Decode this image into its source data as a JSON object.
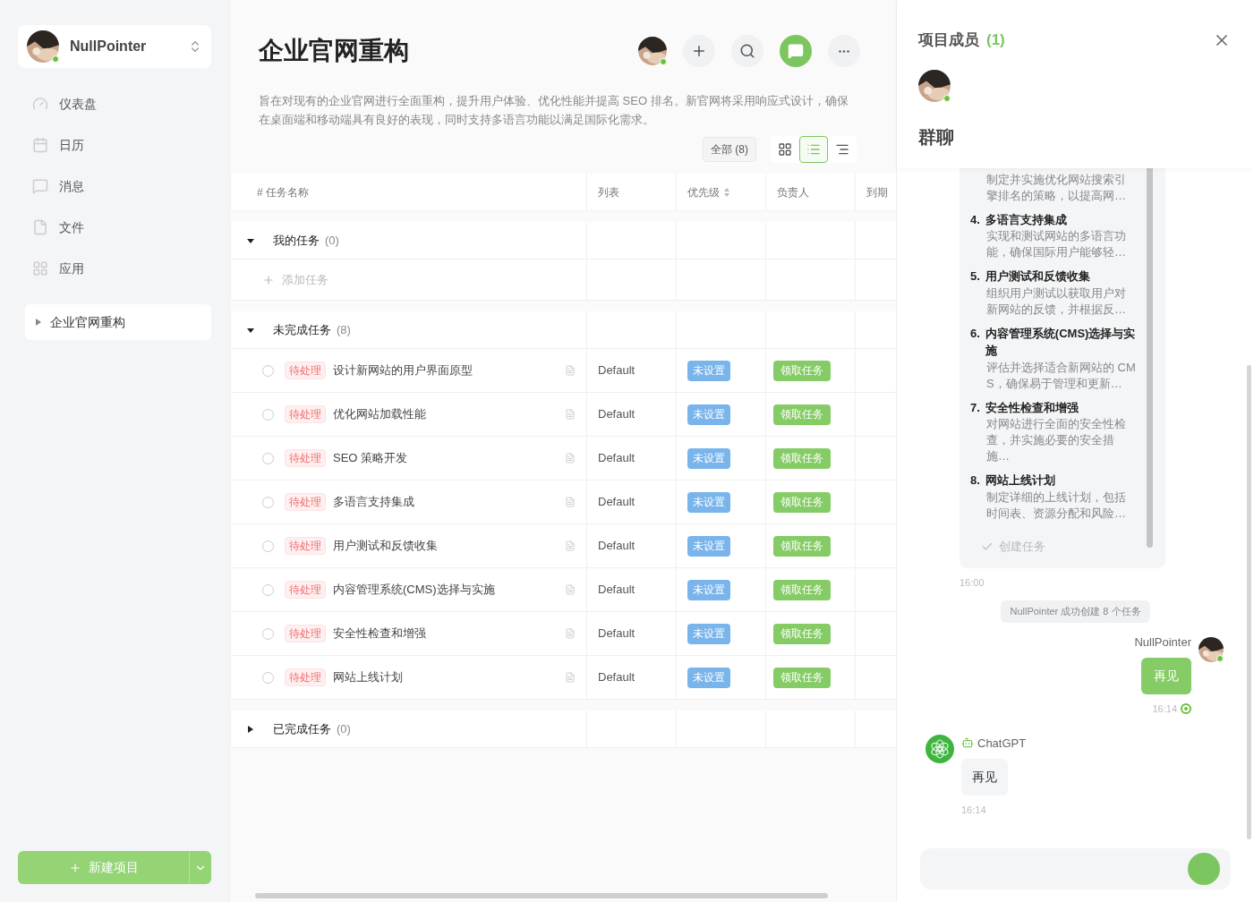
{
  "sidebar": {
    "user": {
      "name": "NullPointer",
      "online": true
    },
    "nav": [
      {
        "label": "仪表盘",
        "kind": "dashboard"
      },
      {
        "label": "日历",
        "kind": "calendar"
      },
      {
        "label": "消息",
        "kind": "message"
      },
      {
        "label": "文件",
        "kind": "file"
      },
      {
        "label": "应用",
        "kind": "apps"
      }
    ],
    "projects": [
      {
        "label": "企业官网重构",
        "expanded": false
      }
    ],
    "new_button": "新建项目"
  },
  "project": {
    "title": "企业官网重构",
    "description": "旨在对现有的企业官网进行全面重构，提升用户体验、优化性能并提高 SEO 排名。新官网将采用响应式设计，确保在桌面端和移动端具有良好的表现，同时支持多语言功能以满足国际化需求。",
    "toolbar": [
      {
        "kind": "avatar",
        "online": true
      },
      {
        "kind": "add"
      },
      {
        "kind": "search"
      },
      {
        "kind": "chat"
      },
      {
        "kind": "more"
      }
    ],
    "chat_open": true,
    "filter": "全部 (8)",
    "views": [
      {
        "kind": "grid",
        "selected": false
      },
      {
        "kind": "list",
        "selected": true
      },
      {
        "kind": "outline",
        "selected": false
      }
    ]
  },
  "table": {
    "columns": [
      {
        "label": "# 任务名称",
        "sortable": false
      },
      {
        "label": "列表",
        "sortable": false
      },
      {
        "label": "优先级",
        "sortable": true
      },
      {
        "label": "负责人",
        "sortable": false
      },
      {
        "label": "到期",
        "sortable": false
      }
    ],
    "sections": [
      {
        "title": "我的任务",
        "count": "(0)",
        "expanded": true,
        "add_label": "添加任务"
      },
      {
        "title": "未完成任务",
        "count": "(8)",
        "expanded": true,
        "tasks": [
          {
            "status": "待处理",
            "name": "设计新网站的用户界面原型",
            "list": "Default",
            "priority": "未设置",
            "action": "领取任务",
            "done": false
          },
          {
            "status": "待处理",
            "name": "优化网站加载性能",
            "list": "Default",
            "priority": "未设置",
            "action": "领取任务",
            "done": false
          },
          {
            "status": "待处理",
            "name": "SEO 策略开发",
            "list": "Default",
            "priority": "未设置",
            "action": "领取任务",
            "done": false
          },
          {
            "status": "待处理",
            "name": "多语言支持集成",
            "list": "Default",
            "priority": "未设置",
            "action": "领取任务",
            "done": false
          },
          {
            "status": "待处理",
            "name": "用户测试和反馈收集",
            "list": "Default",
            "priority": "未设置",
            "action": "领取任务",
            "done": false
          },
          {
            "status": "待处理",
            "name": "内容管理系统(CMS)选择与实施",
            "list": "Default",
            "priority": "未设置",
            "action": "领取任务",
            "done": false
          },
          {
            "status": "待处理",
            "name": "安全性检查和增强",
            "list": "Default",
            "priority": "未设置",
            "action": "领取任务",
            "done": false
          },
          {
            "status": "待处理",
            "name": "网站上线计划",
            "list": "Default",
            "priority": "未设置",
            "action": "领取任务",
            "done": false
          }
        ]
      },
      {
        "title": "已完成任务",
        "count": "(0)",
        "expanded": false
      }
    ]
  },
  "panel": {
    "members_title": "项目成员",
    "members_count": "(1)",
    "members": [
      {
        "online": true
      }
    ],
    "chat_title": "群聊",
    "task_card": {
      "items": [
        {
          "desc": "制定并实施优化网站搜索引擎排名的策略，以提高网…"
        },
        {
          "number": "4.",
          "title": "多语言支持集成",
          "desc": "实现和测试网站的多语言功能，确保国际用户能够轻…"
        },
        {
          "number": "5.",
          "title": "用户测试和反馈收集",
          "desc": "组织用户测试以获取用户对新网站的反馈，并根据反…"
        },
        {
          "number": "6.",
          "title": "内容管理系统(CMS)选择与实施",
          "desc": "评估并选择适合新网站的 CMS，确保易于管理和更新…"
        },
        {
          "number": "7.",
          "title": "安全性检查和增强",
          "desc": "对网站进行全面的安全性检查，并实施必要的安全措施…"
        },
        {
          "number": "8.",
          "title": "网站上线计划",
          "desc": "制定详细的上线计划，包括时间表、资源分配和风险…"
        }
      ],
      "action": "创建任务",
      "time": "16:00"
    },
    "messages": [
      {
        "kind": "system",
        "text": "NullPointer 成功创建 8 个任务"
      },
      {
        "kind": "mine",
        "author": "NullPointer",
        "text": "再见",
        "time": "16:14",
        "read": true
      },
      {
        "kind": "bot",
        "author": "ChatGPT",
        "text": "再见",
        "time": "16:14"
      }
    ]
  }
}
